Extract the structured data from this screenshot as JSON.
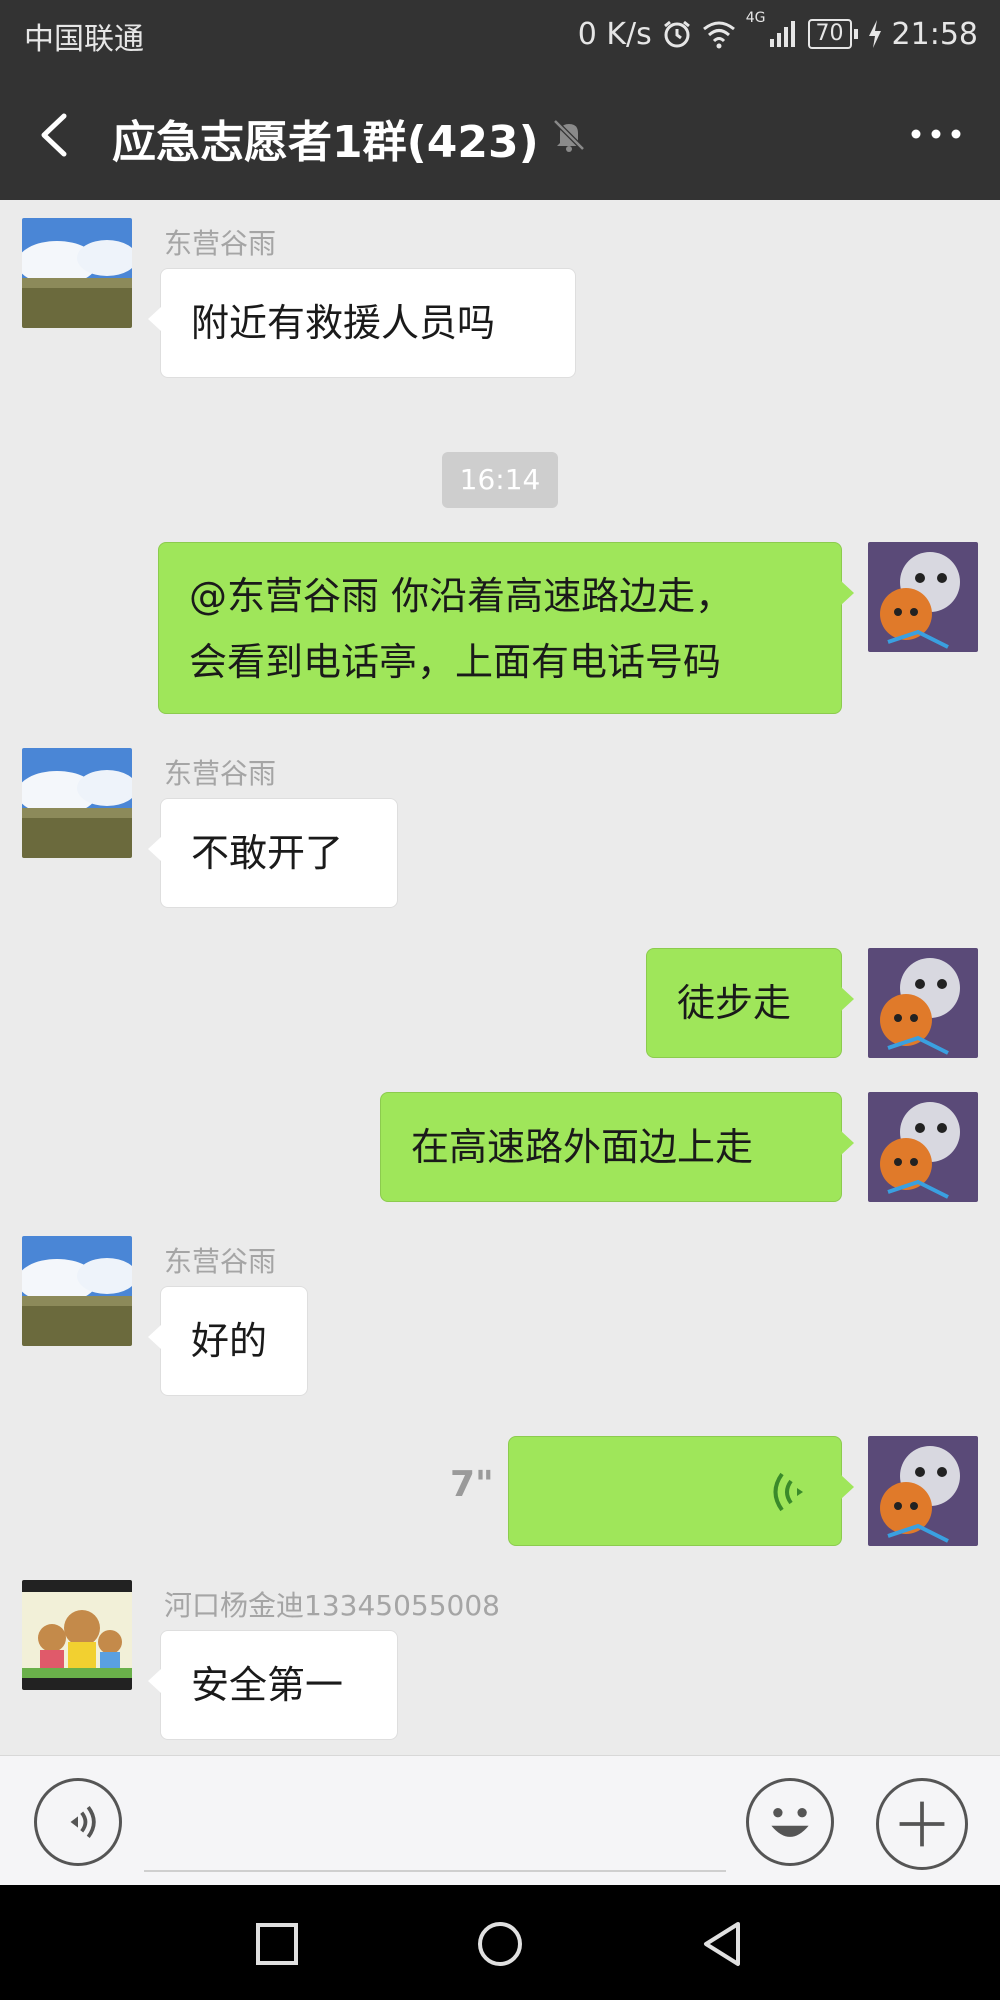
{
  "status_bar": {
    "carrier": "中国联通",
    "net_speed": "0 K/s",
    "network": "4G",
    "battery": "70",
    "time": "21:58"
  },
  "header": {
    "title": "应急志愿者1群(423)",
    "back_icon": "chevron-left-icon",
    "mute_icon": "bell-off-icon",
    "more_icon": "more-horizontal-icon"
  },
  "chat": {
    "timestamp": "16:14",
    "messages": [
      {
        "side": "left",
        "sender": "东营谷雨",
        "text": "附近有救援人员吗"
      },
      {
        "side": "right",
        "lines": [
          "@东营谷雨  你沿着高速路边走，",
          "会看到电话亭，上面有电话号码"
        ]
      },
      {
        "side": "left",
        "sender": "东营谷雨",
        "text": "不敢开了"
      },
      {
        "side": "right",
        "text": "徒步走"
      },
      {
        "side": "right",
        "text": "在高速路外面边上走"
      },
      {
        "side": "left",
        "sender": "东营谷雨",
        "text": "好的"
      },
      {
        "side": "right",
        "type": "voice",
        "duration": "7\""
      },
      {
        "side": "left",
        "sender": "河口杨金迪13345055008",
        "text": "安全第一"
      }
    ]
  },
  "input_bar": {
    "voice_icon": "voice-mode-icon",
    "emoji_icon": "emoji-icon",
    "plus_icon": "plus-icon",
    "placeholder": ""
  },
  "nav_bar": {
    "icons": [
      "recent-apps-icon",
      "home-icon",
      "back-triangle-icon"
    ]
  },
  "colors": {
    "header_bg": "#333333",
    "chat_bg": "#ebebeb",
    "own_bubble": "#9fe65a",
    "other_bubble": "#ffffff"
  }
}
